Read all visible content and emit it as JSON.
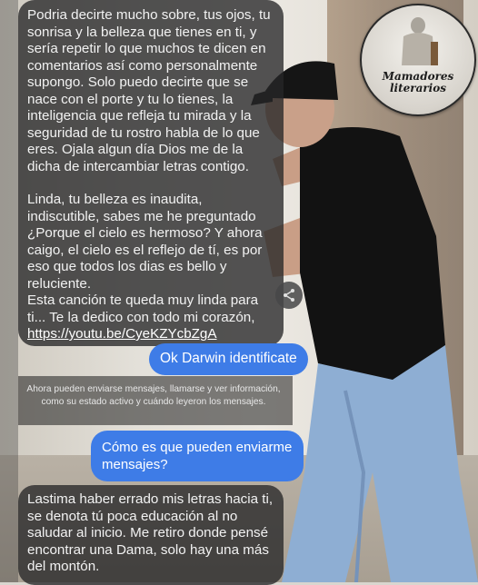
{
  "logo": {
    "line1": "Mamadores",
    "line2": "literarios"
  },
  "messages": {
    "received_1": {
      "para1": "Podria decirte mucho sobre, tus ojos, tu sonrisa y la belleza que tienes en ti, y sería repetir lo que muchos te dicen en comentarios así como personalmente supongo. Solo puedo decirte que se nace con el porte y tu lo tienes, la inteligencia que refleja tu mirada y la seguridad de tu rostro habla de lo que eres. Ojala algun día Dios me de la dicha de intercambiar letras contigo.",
      "para2": "Linda, tu belleza es inaudita, indiscutible, sabes me he preguntado ¿Porque el cielo es hermoso? Y ahora caigo, el cielo es el reflejo de tí, es por eso que todos los dias es bello y reluciente.",
      "para3": "Esta canción te queda muy linda para ti... Te la dedico con todo mi corazón,",
      "link": "https://youtu.be/CyeKZYcbZgA"
    },
    "sent_1": "Ok Darwin identificate",
    "system_notice": "Ahora pueden enviarse mensajes, llamarse y ver información, como su estado activo y cuándo leyeron los mensajes.",
    "sent_2": "Cómo es que pueden enviarme mensajes?",
    "received_2": "Lastima haber errado mis letras hacia ti, se denota tú poca educación al no saludar al inicio. Me retiro donde pensé encontrar una Dama, solo hay una más del montón."
  },
  "icons": {
    "share": "share-icon"
  },
  "colors": {
    "sent_bubble": "#3e7ce7",
    "received_bubble": "#262628"
  }
}
